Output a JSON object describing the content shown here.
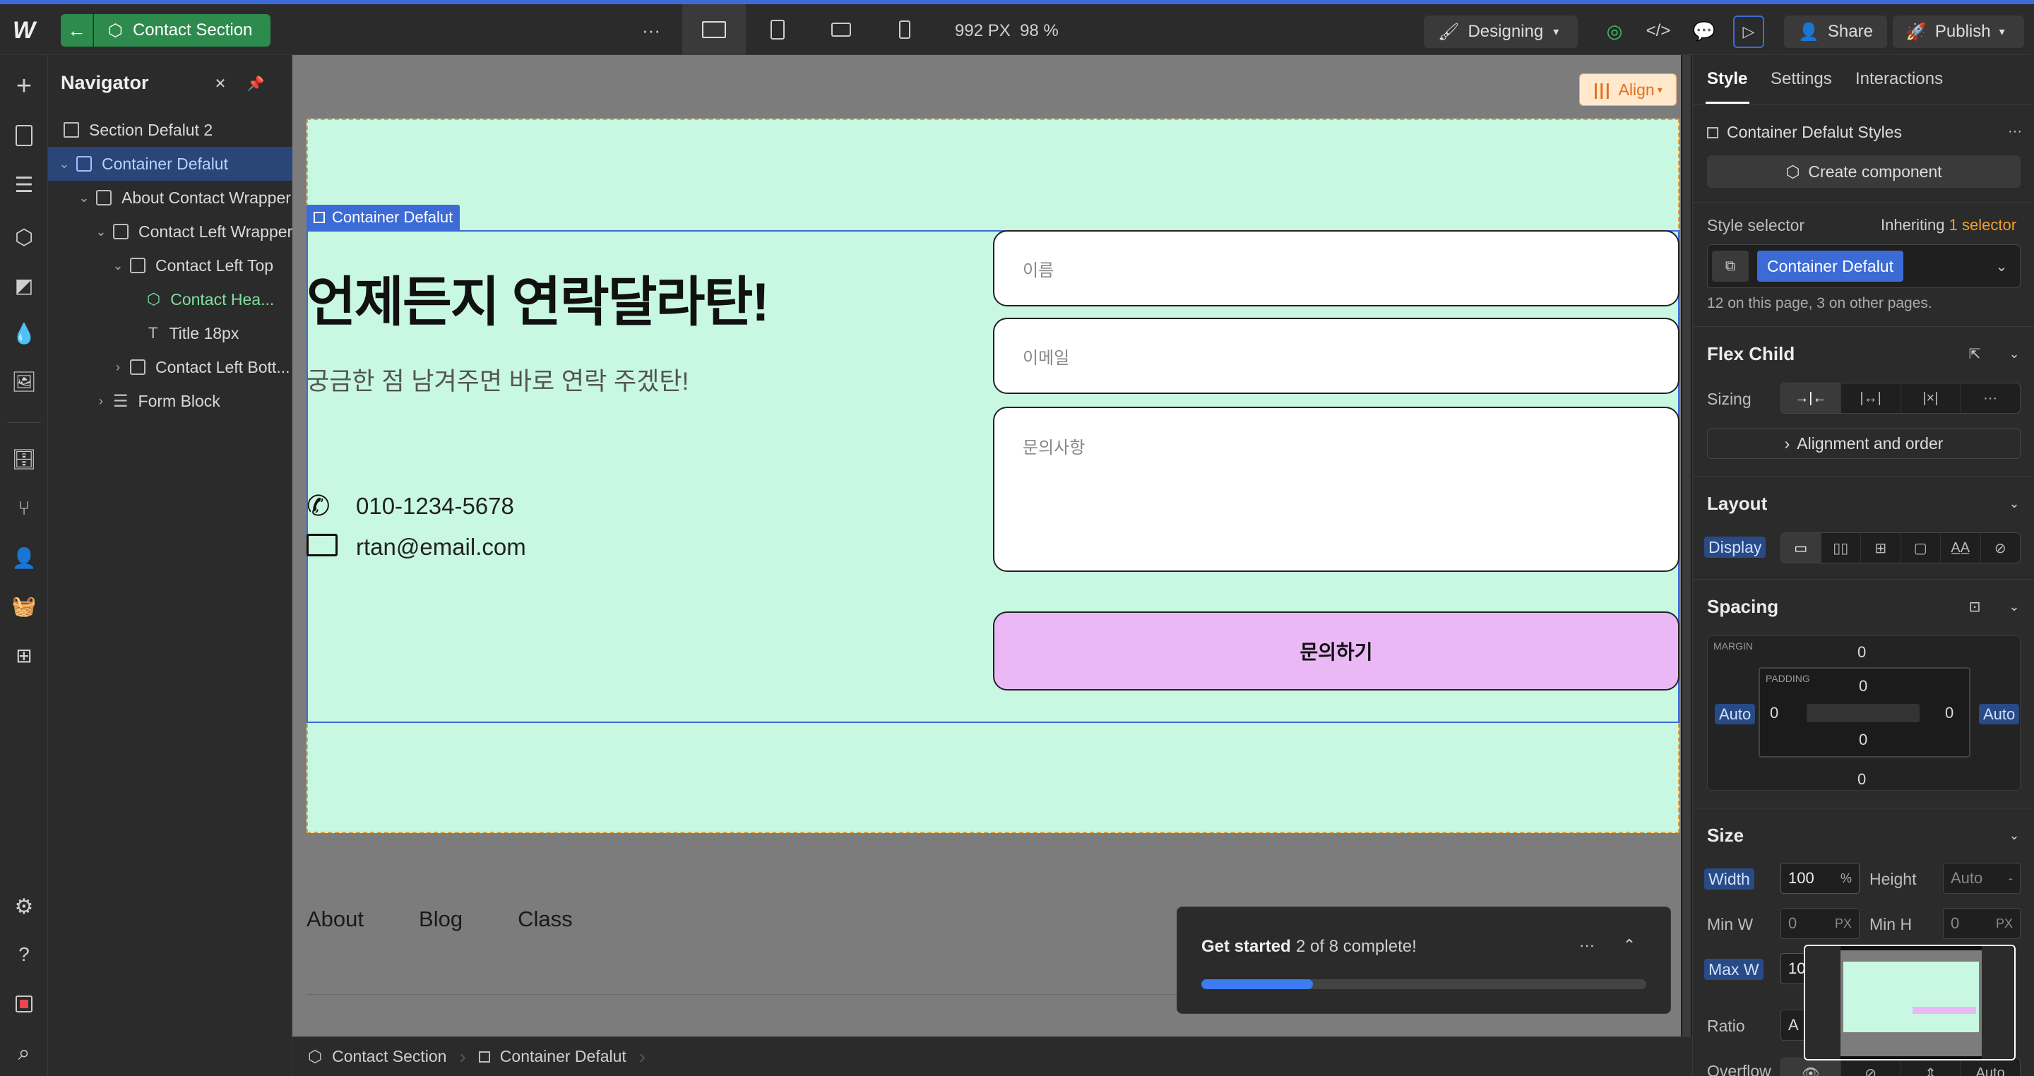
{
  "topbar": {
    "logo": "W",
    "component_label": "Contact Section",
    "more": "···",
    "width_readout": "992 PX",
    "zoom_readout": "98 %",
    "mode_label": "Designing",
    "share_label": "Share",
    "publish_label": "Publish"
  },
  "navigator": {
    "title": "Navigator",
    "items": [
      {
        "label": "Section Defalut 2"
      },
      {
        "label": "Container Defalut"
      },
      {
        "label": "About Contact Wrapper"
      },
      {
        "label": "Contact Left Wrapper"
      },
      {
        "label": "Contact Left Top"
      },
      {
        "label": "Contact Hea..."
      },
      {
        "label": "Title 18px"
      },
      {
        "label": "Contact Left Bott..."
      },
      {
        "label": "Form Block"
      }
    ]
  },
  "canvas": {
    "align_label": "Align",
    "selection_tag": "Container Defalut",
    "heading": "언제든지 연락달라탄!",
    "subheading": "궁금한 점 남겨주면 바로 연락 주겠탄!",
    "phone": "010-1234-5678",
    "email": "rtan@email.com",
    "name_placeholder": "이름",
    "email_placeholder": "이메일",
    "message_placeholder": "문의사항",
    "submit_label": "문의하기",
    "footer_links": [
      "About",
      "Blog",
      "Class"
    ]
  },
  "get_started": {
    "title": "Get started",
    "status": "2 of 8 complete!",
    "progress": 0.25
  },
  "breadcrumb": [
    "Contact Section",
    "Container Defalut"
  ],
  "right_panel": {
    "tabs": [
      "Style",
      "Settings",
      "Interactions"
    ],
    "styles_title": "Container Defalut Styles",
    "create_component": "Create component",
    "style_selector_label": "Style selector",
    "inheriting_prefix": "Inheriting",
    "inheriting_count": "1 selector",
    "selector_chip": "Container Defalut",
    "usage_note": "12 on this page, 3 on other pages.",
    "flex_child_title": "Flex Child",
    "sizing_label": "Sizing",
    "alignment_link": "Alignment and order",
    "layout_title": "Layout",
    "display_label": "Display",
    "spacing_title": "Spacing",
    "margin_label": "MARGIN",
    "padding_label": "PADDING",
    "margin": {
      "top": "0",
      "bottom": "0",
      "left": "Auto",
      "right": "Auto"
    },
    "padding": {
      "top": "0",
      "bottom": "0",
      "left": "0",
      "right": "0"
    },
    "size_title": "Size",
    "width_label": "Width",
    "width_value": "100",
    "width_unit": "%",
    "height_label": "Height",
    "height_value": "Auto",
    "min_w_label": "Min W",
    "min_w_value": "0",
    "min_w_unit": "PX",
    "min_h_label": "Min H",
    "min_h_value": "0",
    "min_h_unit": "PX",
    "max_w_label": "Max W",
    "max_w_value": "10",
    "ratio_label": "Ratio",
    "ratio_value": "A",
    "overflow_label": "Overflow",
    "overflow_auto": "Auto"
  }
}
